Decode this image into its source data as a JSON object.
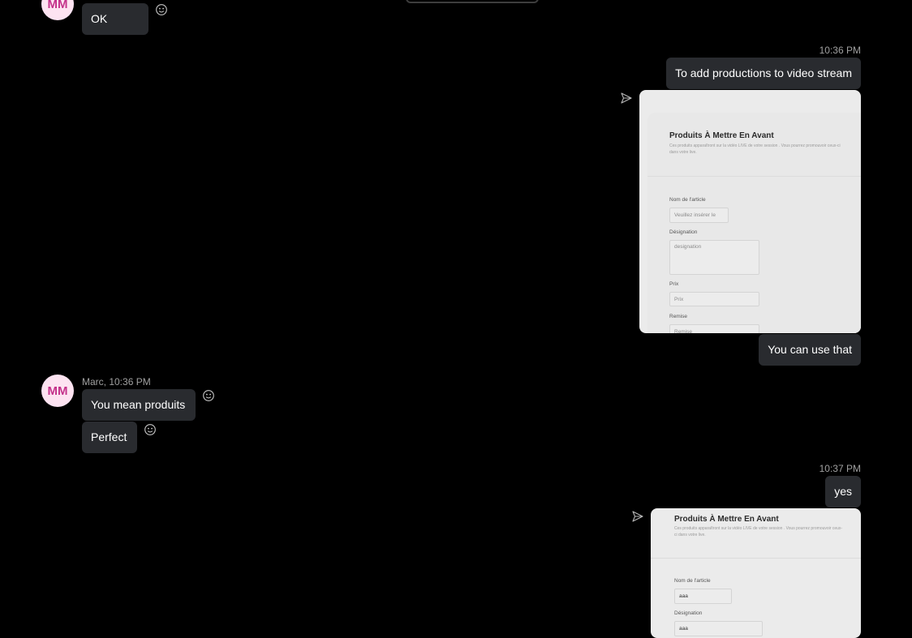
{
  "messages": {
    "ok": {
      "initials": "MM",
      "text": "OK"
    },
    "group1": {
      "time": "10:36 PM",
      "text": "To add productions to video stream"
    },
    "use_that": {
      "text": "You can use that"
    },
    "marc": {
      "sender": "Marc, 10:36 PM",
      "initials": "MM",
      "text1": "You mean produits",
      "text2": "Perfect"
    },
    "group2": {
      "time": "10:37 PM",
      "text": "yes"
    }
  },
  "card1": {
    "title": "Produits À Mettre En Avant",
    "subtitle": "Ces produits apparaîtront sur la vidéo LIVE de votre session . Vous pourrez promouvoir ceux-ci dans votre live.",
    "label_nom": "Nom de l'article",
    "value_nom": "Veuillez insérer le",
    "label_designation": "Désignation",
    "value_designation": "designation",
    "label_prix": "Prix",
    "value_prix": "Prix",
    "label_remise": "Remise",
    "value_remise": "Remise"
  },
  "card2": {
    "title": "Produits À Mettre En Avant",
    "subtitle": "Ces produits apparaîtront sur la vidéo LIVE de votre session . Vous pourrez promouvoir ceux-ci dans votre live.",
    "label_nom": "Nom de l'article",
    "value_nom": "aaa",
    "label_designation": "Désignation",
    "value_designation": "aaa"
  },
  "icons": {
    "avatar": "avatar",
    "reaction": "smiley-reaction-icon",
    "sent": "sent-paper-plane-icon"
  }
}
